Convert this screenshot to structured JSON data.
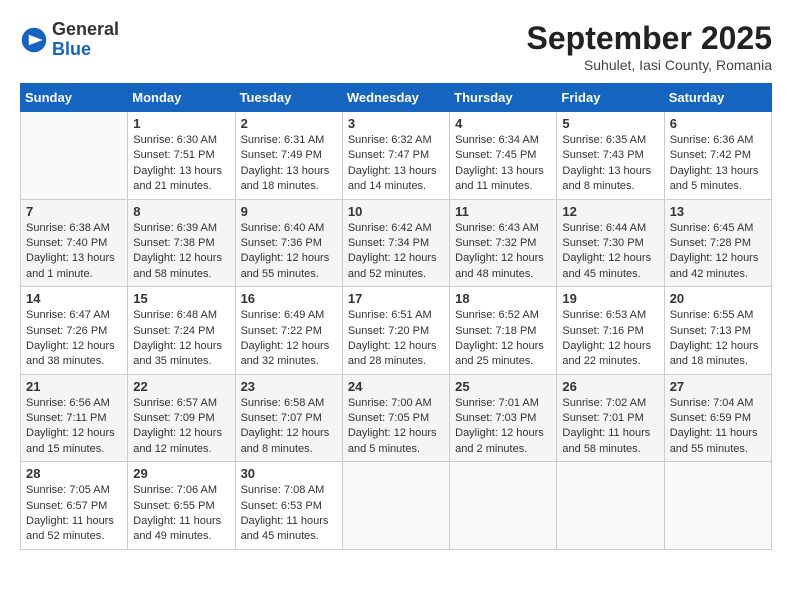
{
  "header": {
    "logo_general": "General",
    "logo_blue": "Blue",
    "month_title": "September 2025",
    "location": "Suhulet, Iasi County, Romania"
  },
  "weekdays": [
    "Sunday",
    "Monday",
    "Tuesday",
    "Wednesday",
    "Thursday",
    "Friday",
    "Saturday"
  ],
  "weeks": [
    [
      {
        "day": "",
        "info": ""
      },
      {
        "day": "1",
        "info": "Sunrise: 6:30 AM\nSunset: 7:51 PM\nDaylight: 13 hours\nand 21 minutes."
      },
      {
        "day": "2",
        "info": "Sunrise: 6:31 AM\nSunset: 7:49 PM\nDaylight: 13 hours\nand 18 minutes."
      },
      {
        "day": "3",
        "info": "Sunrise: 6:32 AM\nSunset: 7:47 PM\nDaylight: 13 hours\nand 14 minutes."
      },
      {
        "day": "4",
        "info": "Sunrise: 6:34 AM\nSunset: 7:45 PM\nDaylight: 13 hours\nand 11 minutes."
      },
      {
        "day": "5",
        "info": "Sunrise: 6:35 AM\nSunset: 7:43 PM\nDaylight: 13 hours\nand 8 minutes."
      },
      {
        "day": "6",
        "info": "Sunrise: 6:36 AM\nSunset: 7:42 PM\nDaylight: 13 hours\nand 5 minutes."
      }
    ],
    [
      {
        "day": "7",
        "info": "Sunrise: 6:38 AM\nSunset: 7:40 PM\nDaylight: 13 hours\nand 1 minute."
      },
      {
        "day": "8",
        "info": "Sunrise: 6:39 AM\nSunset: 7:38 PM\nDaylight: 12 hours\nand 58 minutes."
      },
      {
        "day": "9",
        "info": "Sunrise: 6:40 AM\nSunset: 7:36 PM\nDaylight: 12 hours\nand 55 minutes."
      },
      {
        "day": "10",
        "info": "Sunrise: 6:42 AM\nSunset: 7:34 PM\nDaylight: 12 hours\nand 52 minutes."
      },
      {
        "day": "11",
        "info": "Sunrise: 6:43 AM\nSunset: 7:32 PM\nDaylight: 12 hours\nand 48 minutes."
      },
      {
        "day": "12",
        "info": "Sunrise: 6:44 AM\nSunset: 7:30 PM\nDaylight: 12 hours\nand 45 minutes."
      },
      {
        "day": "13",
        "info": "Sunrise: 6:45 AM\nSunset: 7:28 PM\nDaylight: 12 hours\nand 42 minutes."
      }
    ],
    [
      {
        "day": "14",
        "info": "Sunrise: 6:47 AM\nSunset: 7:26 PM\nDaylight: 12 hours\nand 38 minutes."
      },
      {
        "day": "15",
        "info": "Sunrise: 6:48 AM\nSunset: 7:24 PM\nDaylight: 12 hours\nand 35 minutes."
      },
      {
        "day": "16",
        "info": "Sunrise: 6:49 AM\nSunset: 7:22 PM\nDaylight: 12 hours\nand 32 minutes."
      },
      {
        "day": "17",
        "info": "Sunrise: 6:51 AM\nSunset: 7:20 PM\nDaylight: 12 hours\nand 28 minutes."
      },
      {
        "day": "18",
        "info": "Sunrise: 6:52 AM\nSunset: 7:18 PM\nDaylight: 12 hours\nand 25 minutes."
      },
      {
        "day": "19",
        "info": "Sunrise: 6:53 AM\nSunset: 7:16 PM\nDaylight: 12 hours\nand 22 minutes."
      },
      {
        "day": "20",
        "info": "Sunrise: 6:55 AM\nSunset: 7:13 PM\nDaylight: 12 hours\nand 18 minutes."
      }
    ],
    [
      {
        "day": "21",
        "info": "Sunrise: 6:56 AM\nSunset: 7:11 PM\nDaylight: 12 hours\nand 15 minutes."
      },
      {
        "day": "22",
        "info": "Sunrise: 6:57 AM\nSunset: 7:09 PM\nDaylight: 12 hours\nand 12 minutes."
      },
      {
        "day": "23",
        "info": "Sunrise: 6:58 AM\nSunset: 7:07 PM\nDaylight: 12 hours\nand 8 minutes."
      },
      {
        "day": "24",
        "info": "Sunrise: 7:00 AM\nSunset: 7:05 PM\nDaylight: 12 hours\nand 5 minutes."
      },
      {
        "day": "25",
        "info": "Sunrise: 7:01 AM\nSunset: 7:03 PM\nDaylight: 12 hours\nand 2 minutes."
      },
      {
        "day": "26",
        "info": "Sunrise: 7:02 AM\nSunset: 7:01 PM\nDaylight: 11 hours\nand 58 minutes."
      },
      {
        "day": "27",
        "info": "Sunrise: 7:04 AM\nSunset: 6:59 PM\nDaylight: 11 hours\nand 55 minutes."
      }
    ],
    [
      {
        "day": "28",
        "info": "Sunrise: 7:05 AM\nSunset: 6:57 PM\nDaylight: 11 hours\nand 52 minutes."
      },
      {
        "day": "29",
        "info": "Sunrise: 7:06 AM\nSunset: 6:55 PM\nDaylight: 11 hours\nand 49 minutes."
      },
      {
        "day": "30",
        "info": "Sunrise: 7:08 AM\nSunset: 6:53 PM\nDaylight: 11 hours\nand 45 minutes."
      },
      {
        "day": "",
        "info": ""
      },
      {
        "day": "",
        "info": ""
      },
      {
        "day": "",
        "info": ""
      },
      {
        "day": "",
        "info": ""
      }
    ]
  ]
}
